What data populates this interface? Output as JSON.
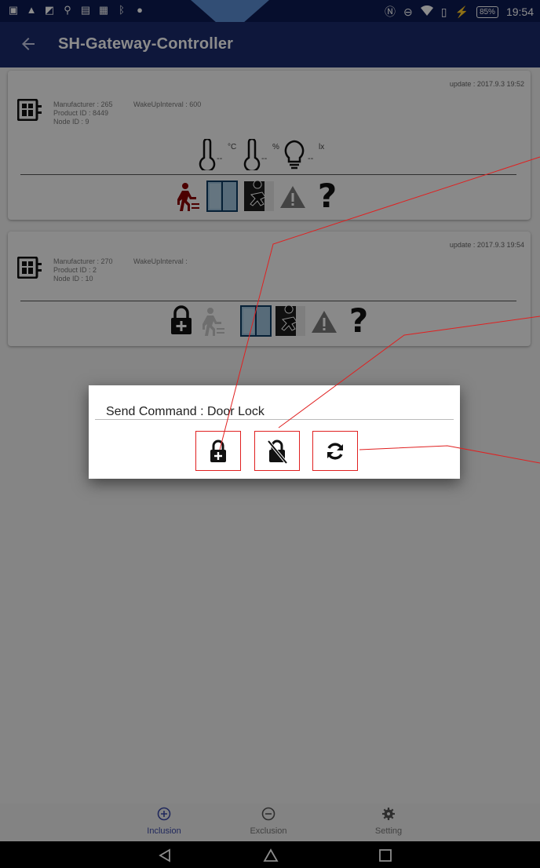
{
  "status_bar": {
    "left_icons": [
      "notification-icon",
      "alert-icon",
      "image-icon",
      "usb-icon",
      "sim-icon",
      "app-icon",
      "bluetooth-icon",
      "android-icon"
    ],
    "battery": "85%",
    "time": "19:54"
  },
  "app_bar": {
    "title": "SH-Gateway-Controller"
  },
  "devices": [
    {
      "update": "update : 2017.9.3 19:52",
      "manufacturer": "Manufacturer : 265",
      "product_id": "Product ID : 8449",
      "node_id": "Node ID : 9",
      "wakeup": "WakeUpInterval : 600",
      "temperature": "--",
      "temperature_unit": "°C",
      "humidity": "--",
      "humidity_unit": "%",
      "illuminance": "--",
      "illuminance_unit": "lx"
    },
    {
      "update": "update : 2017.9.3 19:54",
      "manufacturer": "Manufacturer : 270",
      "product_id": "Product ID : 2",
      "node_id": "Node ID : 10",
      "wakeup": "WakeUpInterval :"
    }
  ],
  "dialog": {
    "title": "Send Command : Door Lock",
    "buttons": [
      "lock-icon",
      "unlock-icon",
      "refresh-icon"
    ]
  },
  "bottom_nav": {
    "items": [
      {
        "label": "Inclusion",
        "icon": "plus-circle-icon",
        "active": true
      },
      {
        "label": "Exclusion",
        "icon": "minus-circle-icon",
        "active": false
      },
      {
        "label": "Setting",
        "icon": "gear-icon",
        "active": false
      }
    ]
  },
  "system_nav": [
    "back-icon",
    "home-icon",
    "recents-icon"
  ],
  "colors": {
    "status_bar": "#0c1a52",
    "app_bar": "#1a2a6c",
    "callout": "#e02020",
    "accent": "#3b4aa8"
  }
}
